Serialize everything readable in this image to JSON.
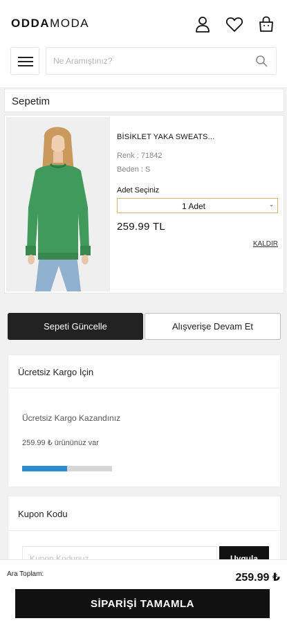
{
  "header": {
    "logo_bold": "ODDA",
    "logo_light": "MODA",
    "icons": [
      "user-icon",
      "heart-icon",
      "shopping-bag-icon",
      "hamburger-menu-icon",
      "search-icon"
    ]
  },
  "search": {
    "placeholder": "Ne Aramıştınız?"
  },
  "cart": {
    "title": "Sepetim"
  },
  "product": {
    "name": "BİSİKLET YAKA SWEATS...",
    "color": "Renk : 71842",
    "size": "Beden : S",
    "quantity_label": "Adet Seçiniz",
    "quantity_value": "1 Adet",
    "price": "259.99 TL",
    "remove_label": "KALDIR",
    "image_colors": {
      "sweater": "#3f9a5c",
      "jeans": "#8fb0cf",
      "background": "#efefef"
    }
  },
  "actions": {
    "update_label": "Sepeti Güncelle",
    "continue_label": "Alışverişe Devam Et"
  },
  "cargo": {
    "title": "Ücretsiz Kargo İçin",
    "won_text": "Ücretsiz Kargo Kazandınız",
    "amount_text": "259.99 ₺ ürününüz var",
    "progress_fraction": 0.5,
    "progress_color": "#2a8bd0"
  },
  "coupon": {
    "title": "Kupon Kodu",
    "placeholder": "Kupon Kodunuz",
    "apply_label": "Uygula"
  },
  "summary": {
    "subtotal_label": "Ara Toplam:",
    "subtotal_value": "259.99 ₺",
    "checkout_label": "SİPARİŞİ TAMAMLA"
  }
}
